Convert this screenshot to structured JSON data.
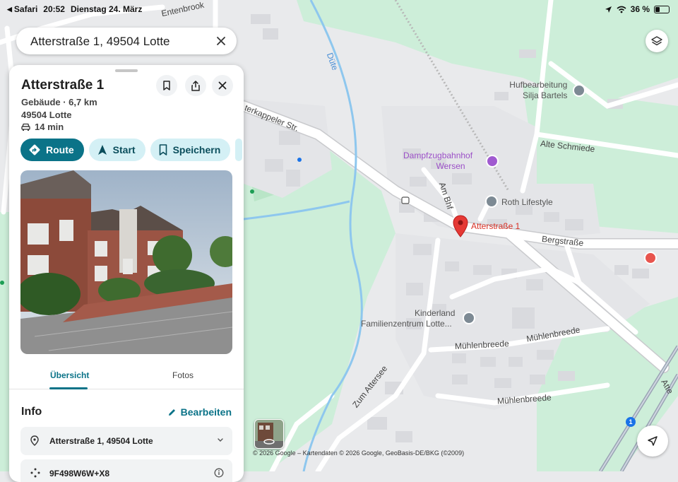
{
  "status_bar": {
    "app": "Safari",
    "time": "20:52",
    "date": "Dienstag 24. März",
    "battery": "36 %"
  },
  "search": {
    "value": "Atterstraße 1, 49504 Lotte",
    "clear_icon": "close-icon"
  },
  "place": {
    "title": "Atterstraße 1",
    "category_distance": "Gebäude · 6,7 km",
    "city": "49504 Lotte",
    "travel_time": "14 min",
    "travel_icon": "car-icon"
  },
  "actions": {
    "route": "Route",
    "start": "Start",
    "save": "Speichern"
  },
  "tabs": [
    {
      "label": "Übersicht",
      "active": true
    },
    {
      "label": "Fotos",
      "active": false
    }
  ],
  "info": {
    "title": "Info",
    "edit_label": "Bearbeiten",
    "address": "Atterstraße 1, 49504 Lotte",
    "plus_code": "9F498W6W+X8"
  },
  "map": {
    "labels": {
      "entenbrook": "Entenbrook",
      "duete": "Düte",
      "tecklenburger": "terkappeler Str.",
      "hufbearbeitung_1": "Hufbearbeitung",
      "hufbearbeitung_2": "Silja Bartels",
      "alte_schmiede": "Alte Schmiede",
      "dampfzug_1": "Dampfzugbahnhof",
      "dampfzug_2": "Wersen",
      "am_bahnhof": "Am Bhf",
      "roth": "Roth Lifestyle",
      "pin_label": "Atterstraße 1",
      "bergstrasse": "Bergstraße",
      "kinderland_1": "Kinderland",
      "kinderland_2": "Familienzentrum Lotte...",
      "muehlenbreede_1": "Mühlenbreede",
      "muehlenbreede_2": "Mühlenbreede",
      "muehlenbreede_3": "Mühlenbreede",
      "zum_attersee": "Zum Attersee",
      "atte": "Atte",
      "route_shield": "1"
    },
    "attribution": "© 2026 Google – Kartendaten © 2026 Google, GeoBasis-DE/BKG (©2009)",
    "colors": {
      "park": "#cdeed9",
      "urban": "#ececee",
      "road": "#ffffff",
      "water": "#8ec7ee",
      "accent": "#0b7388",
      "pin": "#e53935"
    }
  }
}
